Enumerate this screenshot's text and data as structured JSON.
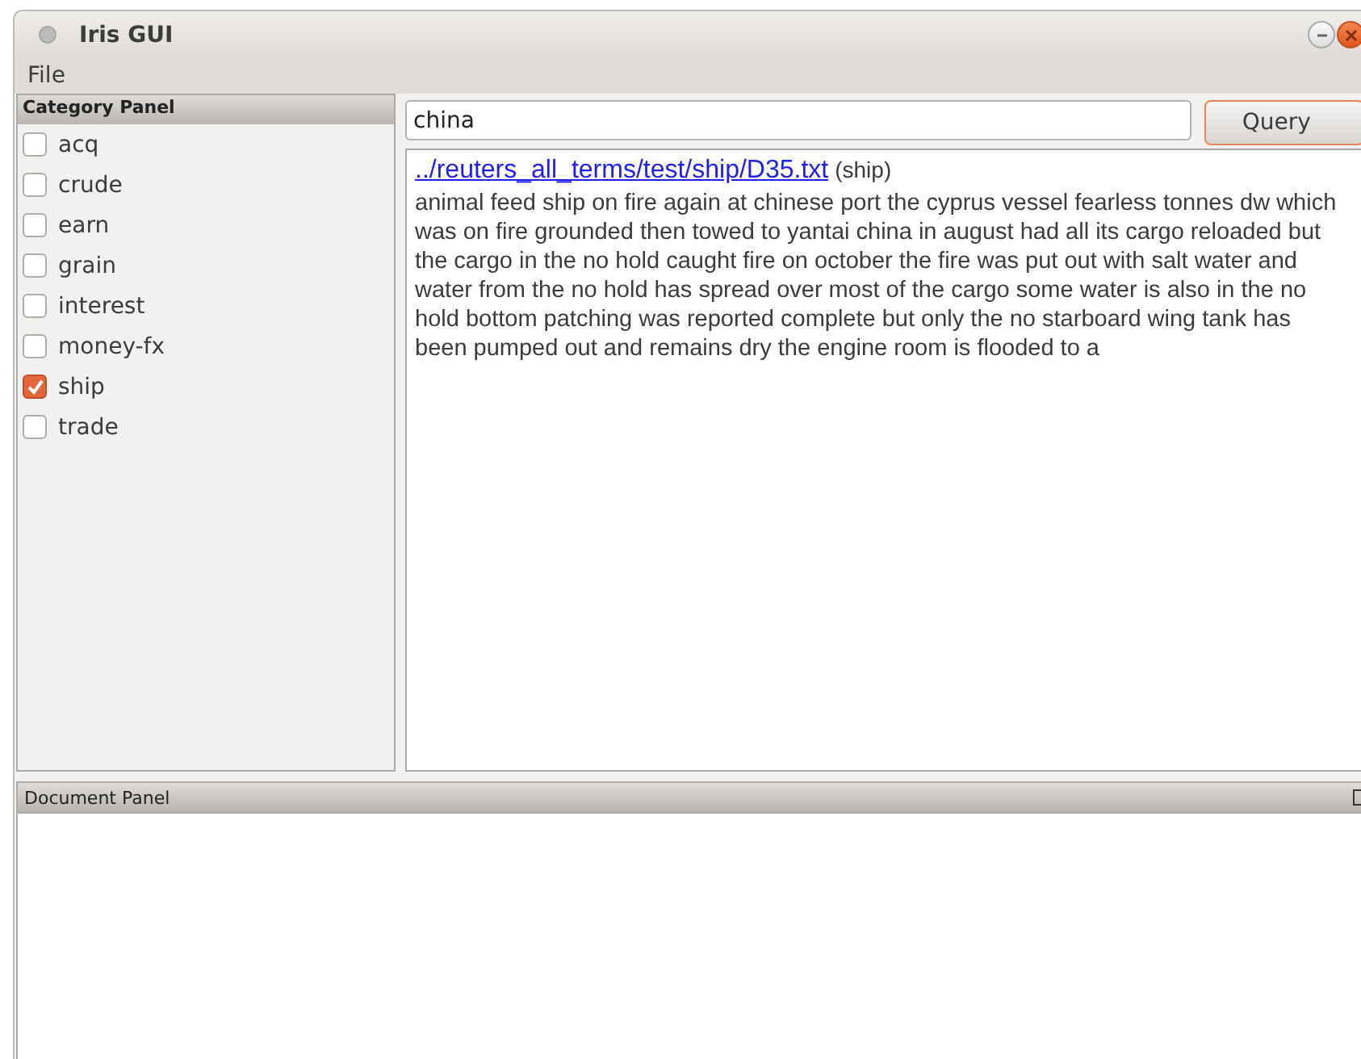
{
  "window": {
    "title": "Iris GUI"
  },
  "menu": [
    "File"
  ],
  "category_panel": {
    "title": "Category Panel",
    "items": [
      {
        "label": "acq",
        "checked": false
      },
      {
        "label": "crude",
        "checked": false
      },
      {
        "label": "earn",
        "checked": false
      },
      {
        "label": "grain",
        "checked": false
      },
      {
        "label": "interest",
        "checked": false
      },
      {
        "label": "money-fx",
        "checked": false
      },
      {
        "label": "ship",
        "checked": true
      },
      {
        "label": "trade",
        "checked": false
      }
    ]
  },
  "search": {
    "value": "china",
    "button": "Query"
  },
  "results": [
    {
      "link": "../reuters_all_terms/test/ship/D35.txt",
      "category": "(ship)",
      "text": "animal feed ship on fire again at chinese port the cyprus vessel fearless tonnes dw which was on fire grounded then towed to yantai china in august had all its cargo reloaded but the cargo in the no hold caught fire on october the fire was put out with salt water and water from the no hold has spread over most of the cargo some water is also in the no hold bottom patching was reported complete but only the no starboard wing tank has been pumped out and remains dry the engine room is flooded to a"
    }
  ],
  "document_panel": {
    "title": "Document Panel"
  }
}
